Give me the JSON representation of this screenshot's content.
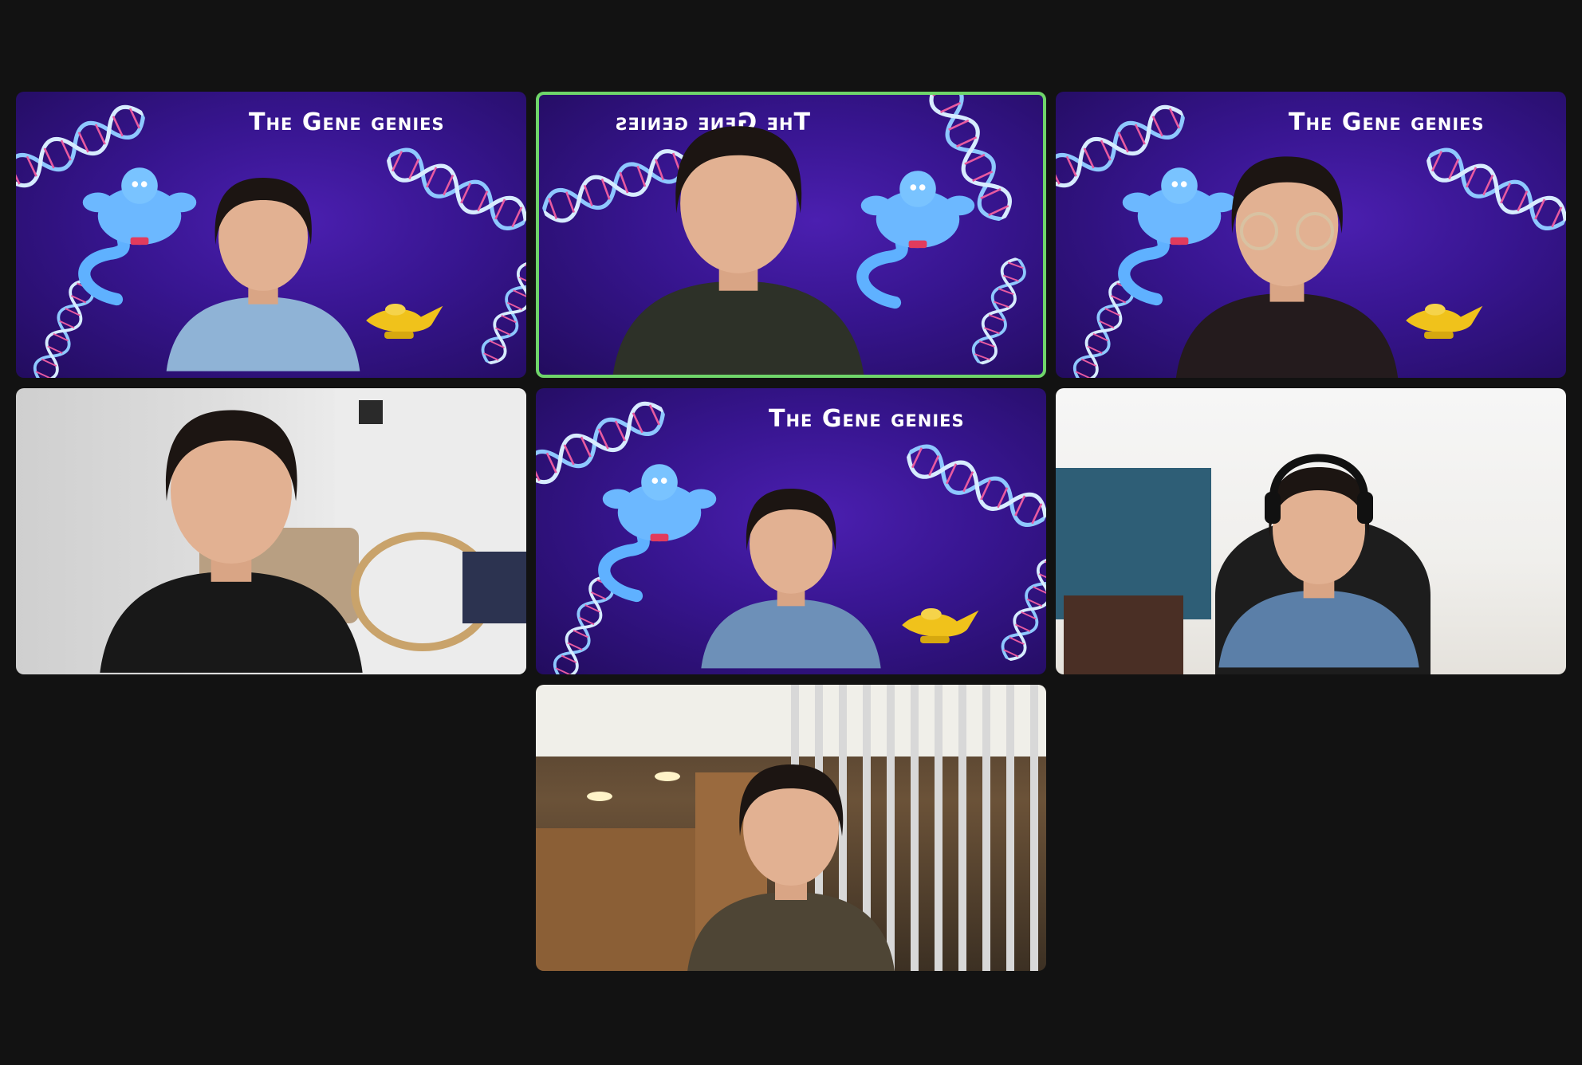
{
  "meeting": {
    "view": "gallery",
    "virtual_background_title": "The Gene genies",
    "colors": {
      "window_bg": "#121212",
      "active_speaker_border": "#6fd56a",
      "background_purple": "#37158f"
    },
    "participants": [
      {
        "id": 1,
        "background": "virtual-gene-genies",
        "active_speaker": false,
        "headphones": true
      },
      {
        "id": 2,
        "background": "virtual-gene-genies-mirrored",
        "active_speaker": true,
        "headphones": false
      },
      {
        "id": 3,
        "background": "virtual-gene-genies",
        "active_speaker": false,
        "headphones": true
      },
      {
        "id": 4,
        "background": "real-living-room",
        "active_speaker": false,
        "headphones": false
      },
      {
        "id": 5,
        "background": "virtual-gene-genies",
        "active_speaker": false,
        "headphones": false
      },
      {
        "id": 6,
        "background": "real-room-desk-chair",
        "active_speaker": false,
        "headphones": true
      },
      {
        "id": 7,
        "background": "real-kitchen",
        "active_speaker": false,
        "headphones": false
      }
    ]
  }
}
